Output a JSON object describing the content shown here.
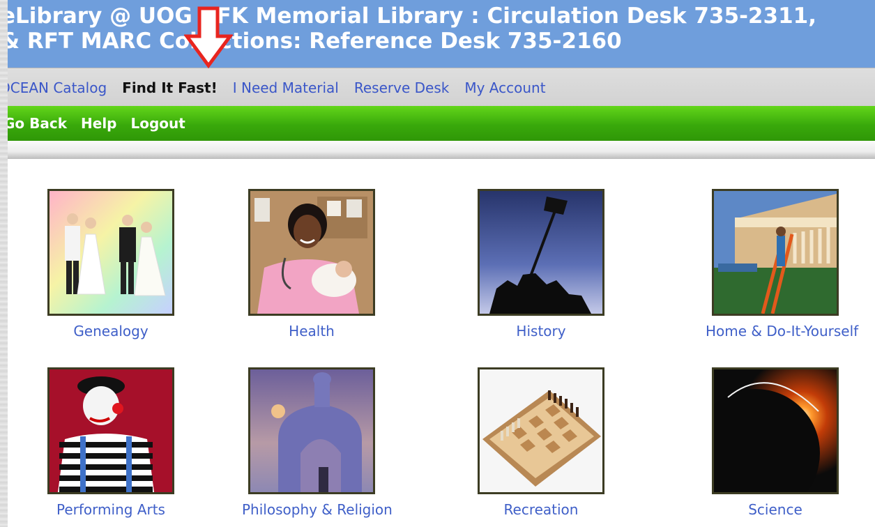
{
  "header": {
    "title_line1": "eLibrary @ UOG RFK Memorial Library : Circulation Desk 735-2311, ",
    "title_line2": "& RFT MARC Collections: Reference Desk 735-2160"
  },
  "nav": {
    "items": [
      {
        "label": "OCEAN Catalog"
      },
      {
        "label": "Find It Fast!"
      },
      {
        "label": "I Need Material"
      },
      {
        "label": "Reserve Desk"
      },
      {
        "label": "My Account"
      }
    ]
  },
  "actions": {
    "items": [
      {
        "label": "Go Back"
      },
      {
        "label": "Help"
      },
      {
        "label": "Logout"
      }
    ]
  },
  "topics": [
    {
      "label": "Genealogy",
      "icon": "wedding-figurines-image"
    },
    {
      "label": "Health",
      "icon": "nurse-with-baby-image"
    },
    {
      "label": "History",
      "icon": "flag-raising-silhouette-image"
    },
    {
      "label": "Home & Do-It-Yourself",
      "icon": "house-construction-image"
    },
    {
      "label": "Performing Arts",
      "icon": "clown-mime-image"
    },
    {
      "label": "Philosophy & Religion",
      "icon": "chapel-dome-image"
    },
    {
      "label": "Recreation",
      "icon": "chessboard-image"
    },
    {
      "label": "Science",
      "icon": "solar-eclipse-image"
    }
  ],
  "annotation": {
    "icon": "red-down-arrow-icon",
    "color": "#e8251f"
  },
  "colors": {
    "title_bar": "#6f9edc",
    "nav_link": "#3a56c8",
    "green_bar": "#39a90b",
    "topic_link": "#3f5fc8"
  }
}
